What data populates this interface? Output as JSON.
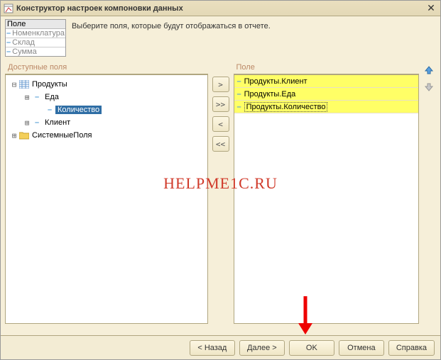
{
  "window": {
    "title": "Конструктор настроек компоновки данных"
  },
  "minitable": {
    "header": "Поле",
    "rows": [
      "Номенклатура",
      "Склад",
      "Сумма"
    ]
  },
  "instruction": "Выберите поля, которые будут отображаться в отчете.",
  "leftPanel": {
    "header": "Доступные поля"
  },
  "rightPanel": {
    "header": "Поле"
  },
  "tree": {
    "n0": "Продукты",
    "n1": "Еда",
    "n2": "Количество",
    "n3": "Клиент",
    "n4": "СистемныеПоля"
  },
  "selected": {
    "r0": "Продукты.Клиент",
    "r1": "Продукты.Еда",
    "r2": "Продукты.Количество"
  },
  "midbtns": {
    "add": ">",
    "addAll": ">>",
    "rem": "<",
    "remAll": "<<"
  },
  "footer": {
    "back": "< Назад",
    "next": "Далее >",
    "ok": "OK",
    "cancel": "Отмена",
    "help": "Справка"
  },
  "watermark": "HELPME1C.RU"
}
